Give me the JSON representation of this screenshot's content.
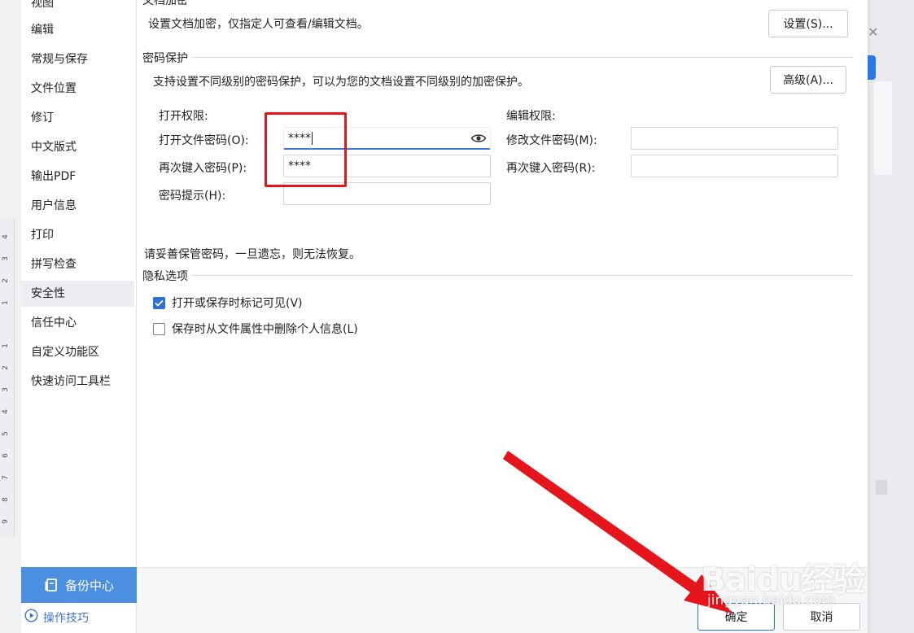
{
  "sidebar": {
    "items": [
      {
        "label": "视图"
      },
      {
        "label": "编辑"
      },
      {
        "label": "常规与保存"
      },
      {
        "label": "文件位置"
      },
      {
        "label": "修订"
      },
      {
        "label": "中文版式"
      },
      {
        "label": "输出PDF"
      },
      {
        "label": "用户信息"
      },
      {
        "label": "打印"
      },
      {
        "label": "拼写检查"
      },
      {
        "label": "安全性"
      },
      {
        "label": "信任中心"
      },
      {
        "label": "自定义功能区"
      },
      {
        "label": "快速访问工具栏"
      }
    ],
    "active_item": "安全性",
    "backup_label": "备份中心",
    "tips_label": "操作技巧"
  },
  "encryption": {
    "title": "文档加密",
    "description": "设置文档加密，仅指定人可查看/编辑文档。",
    "settings_button": "设置(S)..."
  },
  "password": {
    "title": "密码保护",
    "description": "支持设置不同级别的密码保护，可以为您的文档设置不同级别的加密保护。",
    "advanced_button": "高级(A)...",
    "open_group_label": "打开权限:",
    "open_password_label": "打开文件密码(O):",
    "open_password_value": "****",
    "reenter_open_label": "再次键入密码(P):",
    "reenter_open_value": "****",
    "hint_label": "密码提示(H):",
    "hint_value": "",
    "edit_group_label": "编辑权限:",
    "modify_password_label": "修改文件密码(M):",
    "modify_password_value": "",
    "reenter_modify_label": "再次键入密码(R):",
    "reenter_modify_value": "",
    "warning": "请妥善保管密码，一旦遗忘，则无法恢复。"
  },
  "privacy": {
    "title": "隐私选项",
    "option1_label": "打开或保存时标记可见(V)",
    "option1_checked": true,
    "option2_label": "保存时从文件属性中删除个人信息(L)",
    "option2_checked": false
  },
  "footer": {
    "ok_label": "确定",
    "cancel_label": "取消"
  },
  "ruler_labels": [
    "4",
    "3",
    "2",
    "1",
    "1",
    "2",
    "3",
    "4",
    "5",
    "6",
    "7",
    "8",
    "9"
  ],
  "watermark": {
    "brand": "Baidu经验",
    "site": "jingyan.baidu.com"
  },
  "colors": {
    "accent": "#2f6fd6",
    "backup_button": "#4a8fe0",
    "annotation_red": "#e5151b"
  }
}
